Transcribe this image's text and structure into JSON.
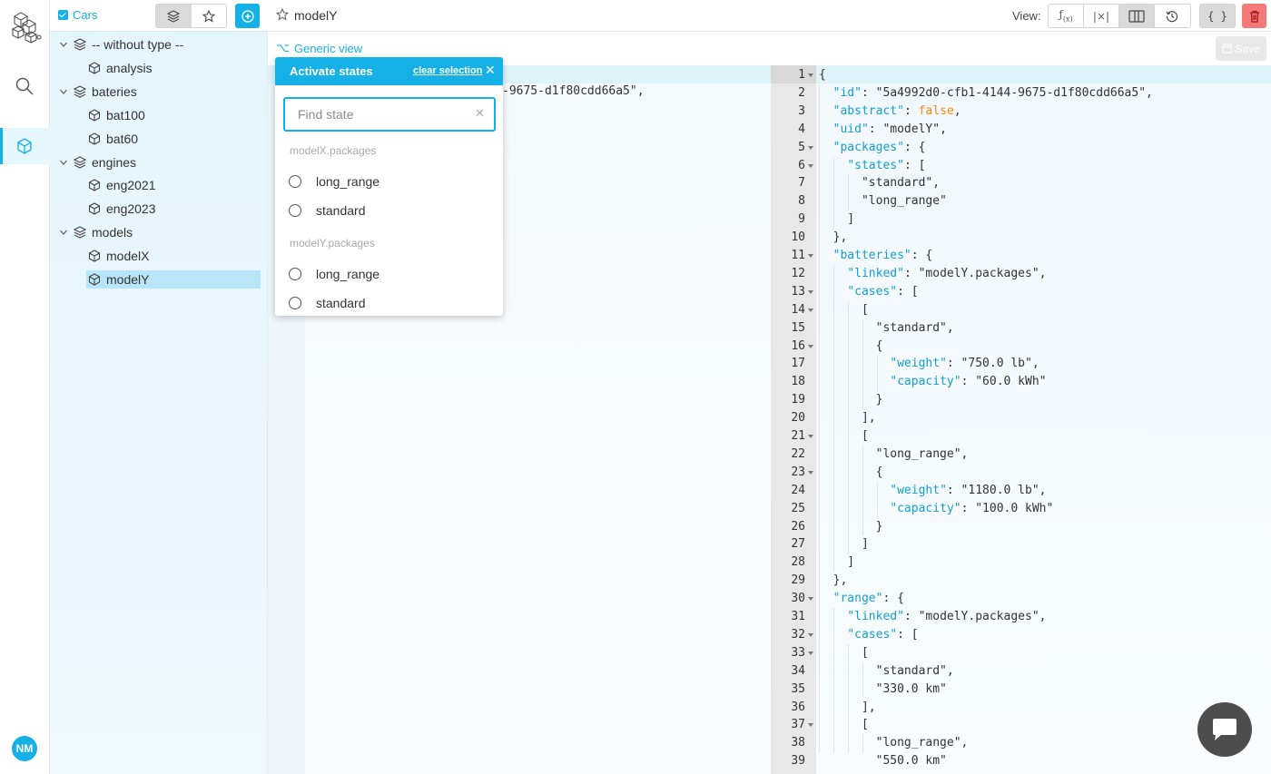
{
  "rail": {
    "avatar_initials": "NM"
  },
  "tree": {
    "project_name": "Cars",
    "nodes": [
      {
        "label": "-- without type --",
        "kind": "type"
      },
      {
        "label": "analysis",
        "kind": "model"
      },
      {
        "label": "bateries",
        "kind": "type"
      },
      {
        "label": "bat100",
        "kind": "model"
      },
      {
        "label": "bat60",
        "kind": "model"
      },
      {
        "label": "engines",
        "kind": "type"
      },
      {
        "label": "eng2021",
        "kind": "model"
      },
      {
        "label": "eng2023",
        "kind": "model"
      },
      {
        "label": "models",
        "kind": "type"
      },
      {
        "label": "modelX",
        "kind": "model"
      },
      {
        "label": "modelY",
        "kind": "model",
        "selected": true
      }
    ]
  },
  "header": {
    "title": "modelY",
    "view_label": "View:",
    "view_buttons": [
      "f(x)",
      "|×|",
      "columns",
      "history"
    ],
    "json_button": "{ }"
  },
  "genbar": {
    "generic_view": "Generic view",
    "save": "Save"
  },
  "left_editor": {
    "fragment": "-9675-d1f80cdd66a5\","
  },
  "popup": {
    "title": "Activate states",
    "clear": "clear selection",
    "search_placeholder": "Find state",
    "groups": [
      {
        "name": "modelX.packages",
        "options": [
          "long_range",
          "standard"
        ]
      },
      {
        "name": "modelY.packages",
        "options": [
          "long_range",
          "standard"
        ]
      }
    ]
  },
  "code": {
    "lines": [
      "{",
      "  \"id\": \"5a4992d0-cfb1-4144-9675-d1f80cdd66a5\",",
      "  \"abstract\": false,",
      "  \"uid\": \"modelY\",",
      "  \"packages\": {",
      "    \"states\": [",
      "      \"standard\",",
      "      \"long_range\"",
      "    ]",
      "  },",
      "  \"batteries\": {",
      "    \"linked\": \"modelY.packages\",",
      "    \"cases\": [",
      "      [",
      "        \"standard\",",
      "        {",
      "          \"weight\": \"750.0 lb\",",
      "          \"capacity\": \"60.0 kWh\"",
      "        }",
      "      ],",
      "      [",
      "        \"long_range\",",
      "        {",
      "          \"weight\": \"1180.0 lb\",",
      "          \"capacity\": \"100.0 kWh\"",
      "        }",
      "      ]",
      "    ]",
      "  },",
      "  \"range\": {",
      "    \"linked\": \"modelY.packages\",",
      "    \"cases\": [",
      "      [",
      "        \"standard\",",
      "        \"330.0 km\"",
      "      ],",
      "      [",
      "        \"long_range\",",
      "        \"550.0 km\""
    ],
    "fold_lines": [
      1,
      5,
      6,
      11,
      13,
      14,
      16,
      21,
      23,
      30,
      32,
      33,
      37
    ]
  }
}
